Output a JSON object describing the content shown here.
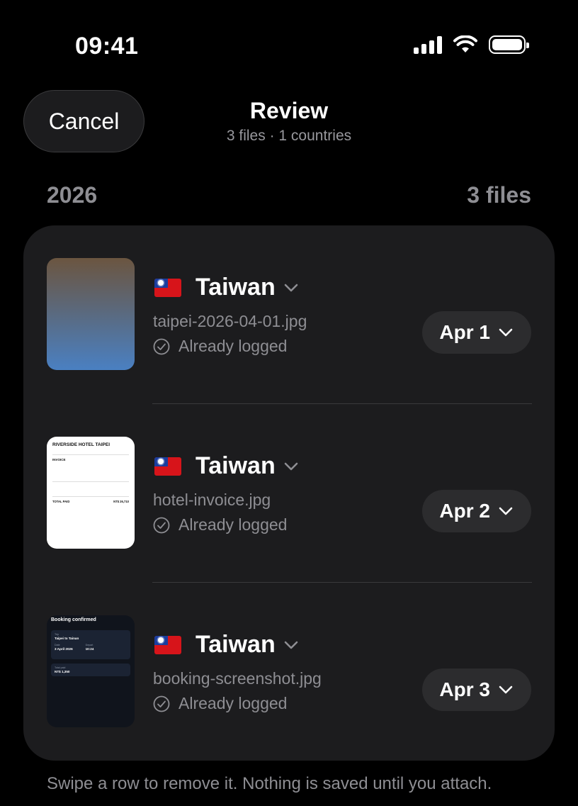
{
  "status_bar": {
    "time": "09:41"
  },
  "header": {
    "cancel_label": "Cancel",
    "title": "Review",
    "subtitle": "3 files · 1 countries"
  },
  "section": {
    "year": "2026",
    "count": "3 files"
  },
  "rows": [
    {
      "country": "Taiwan",
      "flag": "flag-taiwan",
      "filename": "taipei-2026-04-01.jpg",
      "status": "Already logged",
      "date": "Apr 1",
      "thumbnail": "photo"
    },
    {
      "country": "Taiwan",
      "flag": "flag-taiwan",
      "filename": "hotel-invoice.jpg",
      "status": "Already logged",
      "date": "Apr 2",
      "thumbnail": "invoice",
      "thumb_text": {
        "title": "RIVERSIDE HOTEL TAIPEI",
        "heading": "INVOICE",
        "total_label": "TOTAL PAID",
        "total_value": "NT$ 26,710"
      }
    },
    {
      "country": "Taiwan",
      "flag": "flag-taiwan",
      "filename": "booking-screenshot.jpg",
      "status": "Already logged",
      "date": "Apr 3",
      "thumbnail": "booking",
      "thumb_text": {
        "title": "Booking confirmed",
        "trip_label": "Trip",
        "trip_value": "Taipei to Tainan",
        "date_label": "Date",
        "date_value": "3 April 2026",
        "depart_label": "Depart",
        "depart_value": "10:24",
        "total_label": "Total paid",
        "total_value": "NT$ 1,350"
      }
    }
  ],
  "footer": {
    "note": "Swipe a row to remove it. Nothing is saved until you attach."
  },
  "colors": {
    "background": "#000000",
    "card": "#1c1c1e",
    "pill": "#2c2c2e",
    "secondary_text": "#8e8e93"
  }
}
